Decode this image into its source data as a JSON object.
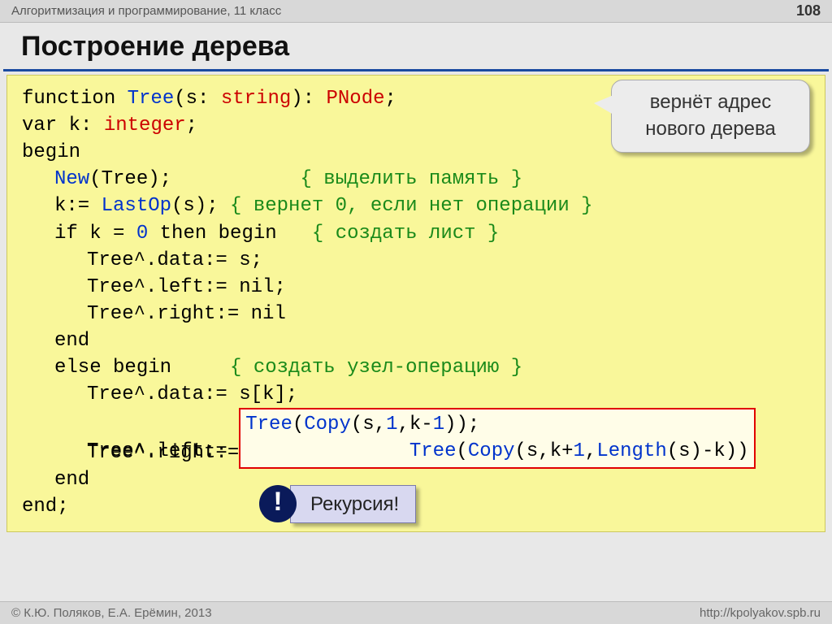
{
  "header": {
    "course": "Алгоритмизация и программирование, 11 класс",
    "page": "108"
  },
  "title": "Построение дерева",
  "callout": "вернёт адрес нового дерева",
  "code": {
    "l1_function": "function",
    "l1_tree": "Tree",
    "l1_sig1": "(s: ",
    "l1_string": "string",
    "l1_sig2": "): ",
    "l1_pnode": "PNode",
    "l1_semi": ";",
    "l2_var": "var",
    "l2_k": " k: ",
    "l2_integer": "integer",
    "l2_semi": ";",
    "l3_begin": "begin",
    "l4_new": "New",
    "l4_tree": "(Tree);",
    "l4_pad": "           ",
    "l4_comment": "{ выделить память }",
    "l5_k": "k:= ",
    "l5_lastop": "LastOp",
    "l5_s": "(s); ",
    "l5_comment": "{ вернет 0, если нет операции }",
    "l6_if": "if",
    "l6_keq": " k = ",
    "l6_zero": "0",
    "l6_then": " then begin",
    "l6_pad": "   ",
    "l6_comment": "{ создать лист }",
    "l7": "Tree^.data:= s;",
    "l8": "Tree^.left:= nil;",
    "l9": "Tree^.right:= nil",
    "l10_end": "end",
    "l11_else": "else begin",
    "l11_pad": "     ",
    "l11_comment": "{ создать узел-операцию }",
    "l12": "Tree^.data:= s[k];",
    "l13_pre": "Tree^.left:= ",
    "l13_redbox_a": "Tree",
    "l13_redbox_b": "(",
    "l13_redbox_c": "Copy",
    "l13_redbox_d": "(s,",
    "l13_redbox_e": "1",
    "l13_redbox_f": ",k-",
    "l13_redbox_g": "1",
    "l13_redbox_h": "));",
    "l14_pre": "Tree^.right:= ",
    "l14_redbox_a": "Tree",
    "l14_redbox_b": "(",
    "l14_redbox_c": "Copy",
    "l14_redbox_d": "(s,k+",
    "l14_redbox_e": "1",
    "l14_redbox_f": ",",
    "l14_redbox_g": "Length",
    "l14_redbox_h": "(s)-k))",
    "l15_end": "end",
    "l16_end": "end",
    "l16_semi": ";"
  },
  "bang": "!",
  "recursion": "Рекурсия!",
  "footer": {
    "authors": "© К.Ю. Поляков, Е.А. Ерёмин, 2013",
    "url": "http://kpolyakov.spb.ru"
  }
}
